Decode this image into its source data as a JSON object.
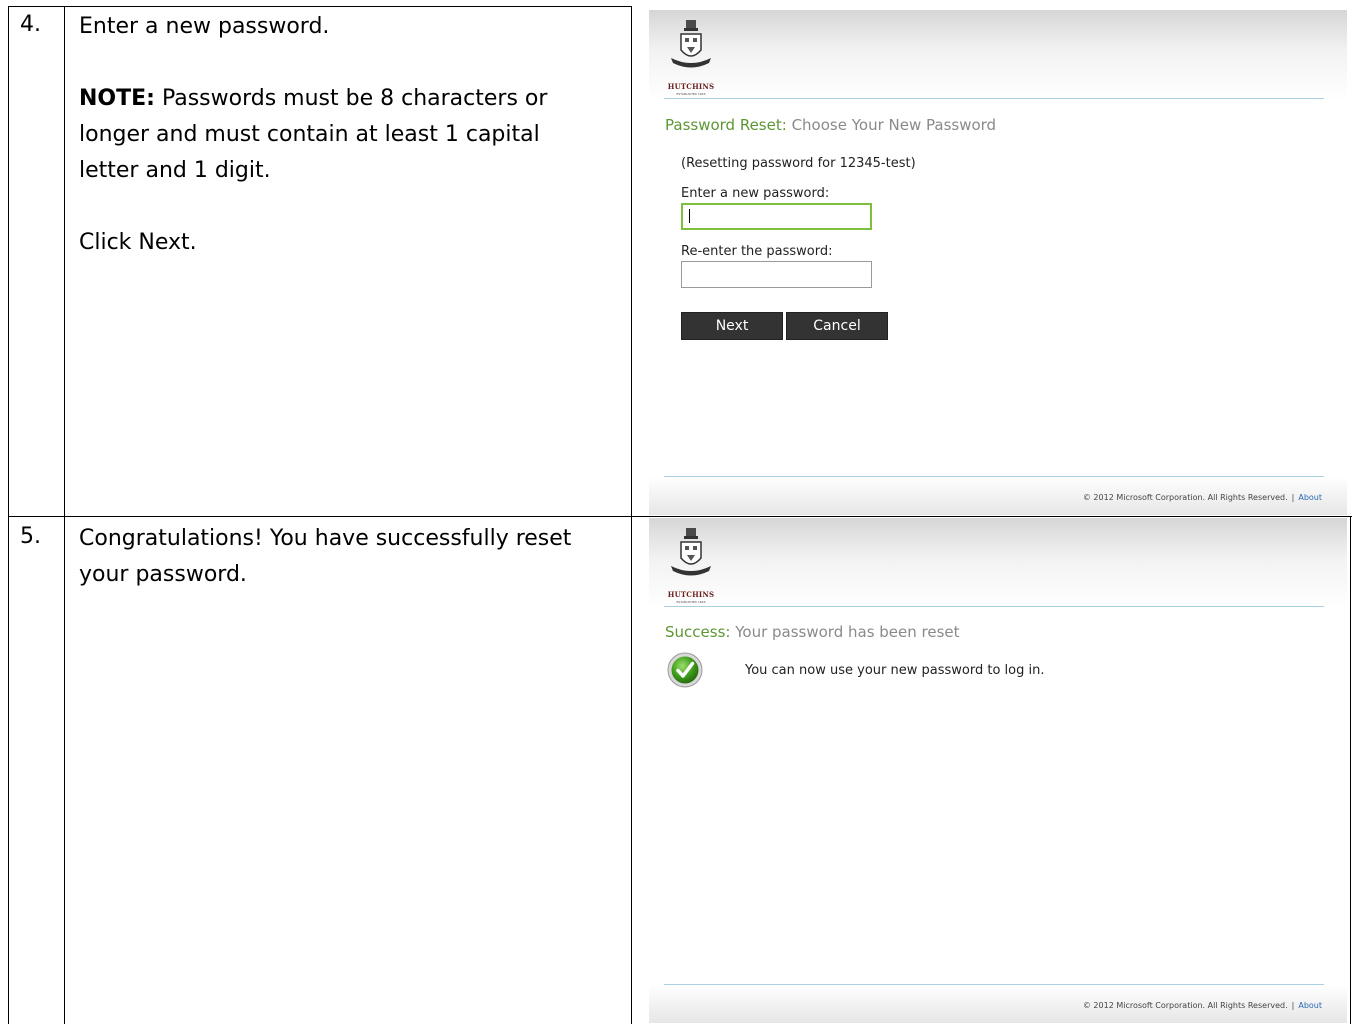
{
  "steps": [
    {
      "number": "4.",
      "instruction": "Enter a new password.",
      "note_label": "NOTE:",
      "note_line1": " Passwords must be 8 characters or",
      "note_line2": "longer and must contain at least 1 capital",
      "note_line3": "letter and 1 digit.",
      "action": "Click Next."
    },
    {
      "number": "5.",
      "message_line1": "Congratulations!  You have successfully reset",
      "message_line2": "your password."
    }
  ],
  "reset_screen": {
    "logo_text": "HUTCHINS",
    "logo_subtext": "ESTABLISHED 1846",
    "heading_label": "Password Reset:",
    "heading_title": "Choose Your New Password",
    "resetting_for": "(Resetting password for 12345-test)",
    "new_password_label": "Enter a new password:",
    "reenter_password_label": "Re-enter the password:",
    "next_button": "Next",
    "cancel_button": "Cancel",
    "footer_copyright": "© 2012 Microsoft Corporation. All Rights Reserved.",
    "footer_separator": "|",
    "footer_about": "About"
  },
  "success_screen": {
    "logo_text": "HUTCHINS",
    "logo_subtext": "ESTABLISHED 1846",
    "heading_label": "Success:",
    "heading_title": "Your password has been reset",
    "message": "You can now use your new password to log in.",
    "footer_copyright": "© 2012 Microsoft Corporation. All Rights Reserved.",
    "footer_separator": "|",
    "footer_about": "About"
  },
  "colors": {
    "heading_green": "#5d9732",
    "heading_gray": "#8a8a8a",
    "button_dark": "#333333",
    "focus_green": "#7fbf3f",
    "rule_blue": "#a9cfe2",
    "link_blue": "#2a6ab3"
  }
}
